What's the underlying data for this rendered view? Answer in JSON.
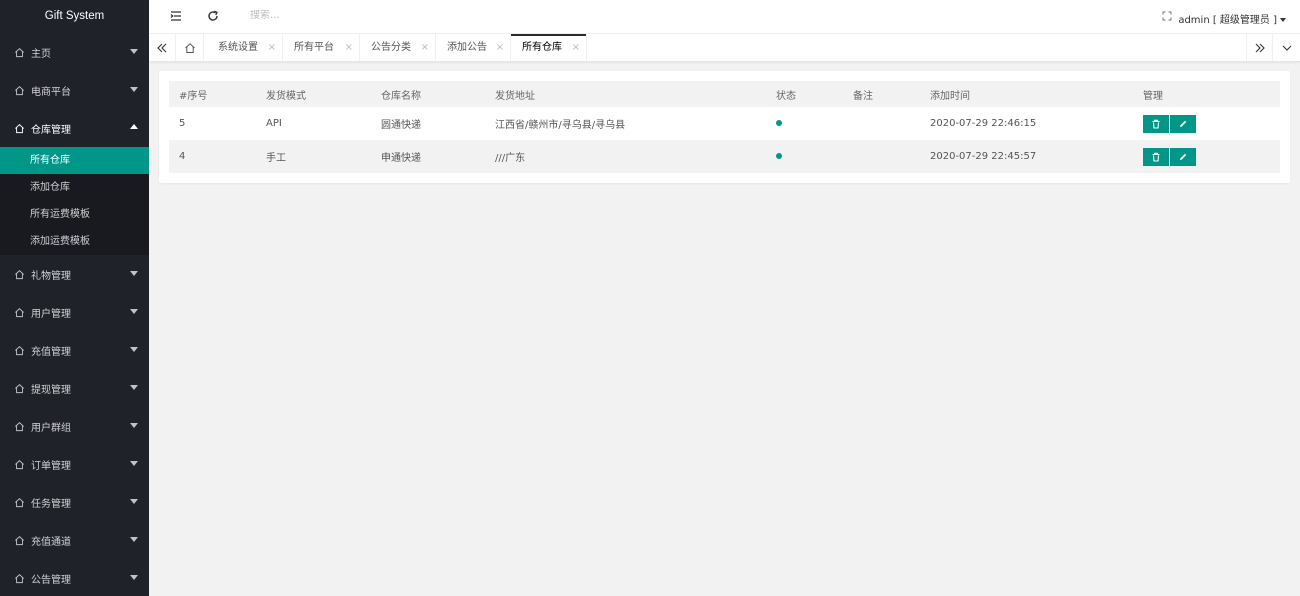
{
  "app": {
    "title": "Gift System"
  },
  "sidebar": {
    "items": [
      {
        "label": "主页",
        "open": false
      },
      {
        "label": "电商平台",
        "open": false
      },
      {
        "label": "仓库管理",
        "open": true,
        "children": [
          "所有仓库",
          "添加仓库",
          "所有运费模板",
          "添加运费模板"
        ],
        "active_child": "所有仓库"
      },
      {
        "label": "礼物管理",
        "open": false
      },
      {
        "label": "用户管理",
        "open": false
      },
      {
        "label": "充值管理",
        "open": false
      },
      {
        "label": "提现管理",
        "open": false
      },
      {
        "label": "用户群组",
        "open": false
      },
      {
        "label": "订单管理",
        "open": false
      },
      {
        "label": "任务管理",
        "open": false
      },
      {
        "label": "充值通道",
        "open": false
      },
      {
        "label": "公告管理",
        "open": false
      }
    ]
  },
  "header": {
    "search_placeholder": "搜索...",
    "user_label": "admin [ 超级管理员 ]"
  },
  "tabs": {
    "items": [
      "系统设置",
      "所有平台",
      "公告分类",
      "添加公告",
      "所有仓库"
    ],
    "active": "所有仓库",
    "close_glyph": "×"
  },
  "table": {
    "columns": [
      "#序号",
      "发货模式",
      "仓库名称",
      "发货地址",
      "状态",
      "备注",
      "添加时间",
      "管理"
    ],
    "rows": [
      {
        "id": "5",
        "mode": "API",
        "name": "圆通快递",
        "address": "江西省/赣州市/寻乌县/寻乌县",
        "status": "active",
        "remark": "",
        "added": "2020-07-29 22:46:15"
      },
      {
        "id": "4",
        "mode": "手工",
        "name": "申通快递",
        "address": "///广东",
        "status": "active",
        "remark": "",
        "added": "2020-07-29 22:45:57"
      }
    ]
  },
  "colors": {
    "accent": "#009688",
    "sidebar_bg": "#20222a",
    "submenu_bg": "#191a20"
  }
}
